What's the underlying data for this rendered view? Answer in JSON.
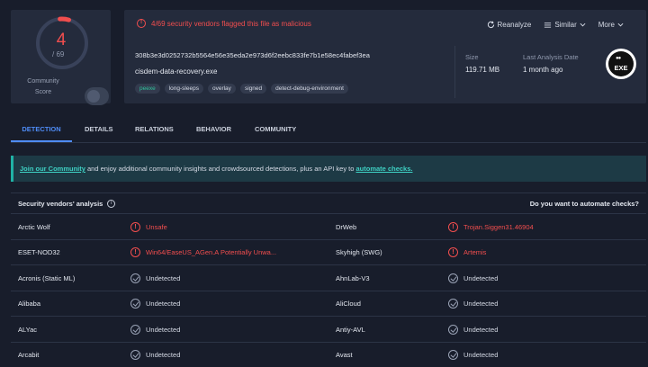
{
  "score": {
    "value": "4",
    "total": "/ 69",
    "community_label": "Community Score"
  },
  "file": {
    "flag_text": "4/69 security vendors flagged this file as malicious",
    "hash": "308b3e3d0252732b5564e56e35eda2e973d6f2eebc833fe7b1e58ec4fabef3ea",
    "name": "cisdem-data-recovery.exe",
    "tags": [
      "peexe",
      "long-sleeps",
      "overlay",
      "signed",
      "detect-debug-environment"
    ],
    "size_label": "Size",
    "size_value": "119.71 MB",
    "last_analysis_label": "Last Analysis Date",
    "last_analysis_value": "1 month ago",
    "type_icon_text": "EXE"
  },
  "actions": {
    "reanalyze": "Reanalyze",
    "similar": "Similar",
    "more": "More"
  },
  "tabs": [
    "DETECTION",
    "DETAILS",
    "RELATIONS",
    "BEHAVIOR",
    "COMMUNITY"
  ],
  "banner": {
    "link1": "Join our Community",
    "middle": " and enjoy additional community insights and crowdsourced detections, plus an API key to ",
    "link2": "automate checks."
  },
  "analysis": {
    "title": "Security vendors' analysis",
    "automate_question": "Do you want to automate checks?",
    "rows": [
      {
        "v1": "Arctic Wolf",
        "r1": "Unsafe",
        "s1": "bad",
        "v2": "DrWeb",
        "r2": "Trojan.Siggen31.46904",
        "s2": "bad"
      },
      {
        "v1": "ESET-NOD32",
        "r1": "Win64/EaseUS_AGen.A Potentially Unwa...",
        "s1": "bad",
        "v2": "Skyhigh (SWG)",
        "r2": "Artemis",
        "s2": "bad"
      },
      {
        "v1": "Acronis (Static ML)",
        "r1": "Undetected",
        "s1": "ok",
        "v2": "AhnLab-V3",
        "r2": "Undetected",
        "s2": "ok"
      },
      {
        "v1": "Alibaba",
        "r1": "Undetected",
        "s1": "ok",
        "v2": "AliCloud",
        "r2": "Undetected",
        "s2": "ok"
      },
      {
        "v1": "ALYac",
        "r1": "Undetected",
        "s1": "ok",
        "v2": "Antiy-AVL",
        "r2": "Undetected",
        "s2": "ok"
      },
      {
        "v1": "Arcabit",
        "r1": "Undetected",
        "s1": "ok",
        "v2": "Avast",
        "r2": "Undetected",
        "s2": "ok"
      }
    ]
  },
  "colors": {
    "malicious": "#f24e4e",
    "accent": "#4f8cf7",
    "banner_link": "#3ed0c3"
  }
}
